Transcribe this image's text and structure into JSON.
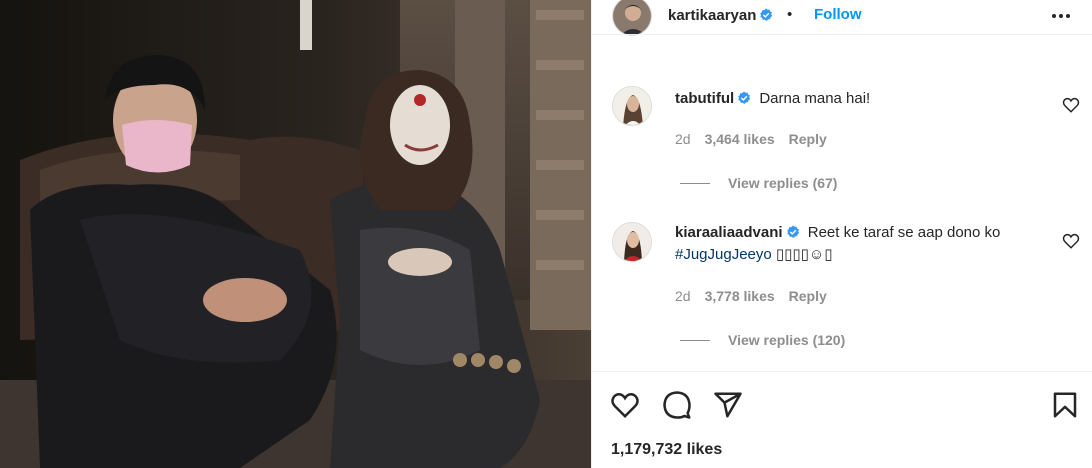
{
  "post": {
    "username": "kartikaaryan",
    "separator": "•",
    "follow_label": "Follow",
    "likes_count": "1,179,732 likes"
  },
  "comments": [
    {
      "username": "tabutiful",
      "text": "Darna mana hai!",
      "hashtag": "",
      "age": "2d",
      "likes": "3,464 likes",
      "reply_label": "Reply",
      "view_replies": "View replies (67)"
    },
    {
      "username": "kiaraaliaadvani",
      "text": "Reet ke taraf se aap dono ko ",
      "hashtag": "#JugJugJeeyo",
      "emoji": " ▯▯▯▯☺▯",
      "age": "2d",
      "likes": "3,778 likes",
      "reply_label": "Reply",
      "view_replies": "View replies (120)"
    }
  ],
  "colors": {
    "accent": "#0095f6",
    "verified": "#3897f0",
    "muted": "#8e8e8e",
    "hashtag": "#00376b"
  },
  "icons": [
    "verified-badge-icon",
    "more-options-icon",
    "heart-icon",
    "comment-icon",
    "share-icon",
    "bookmark-icon"
  ]
}
